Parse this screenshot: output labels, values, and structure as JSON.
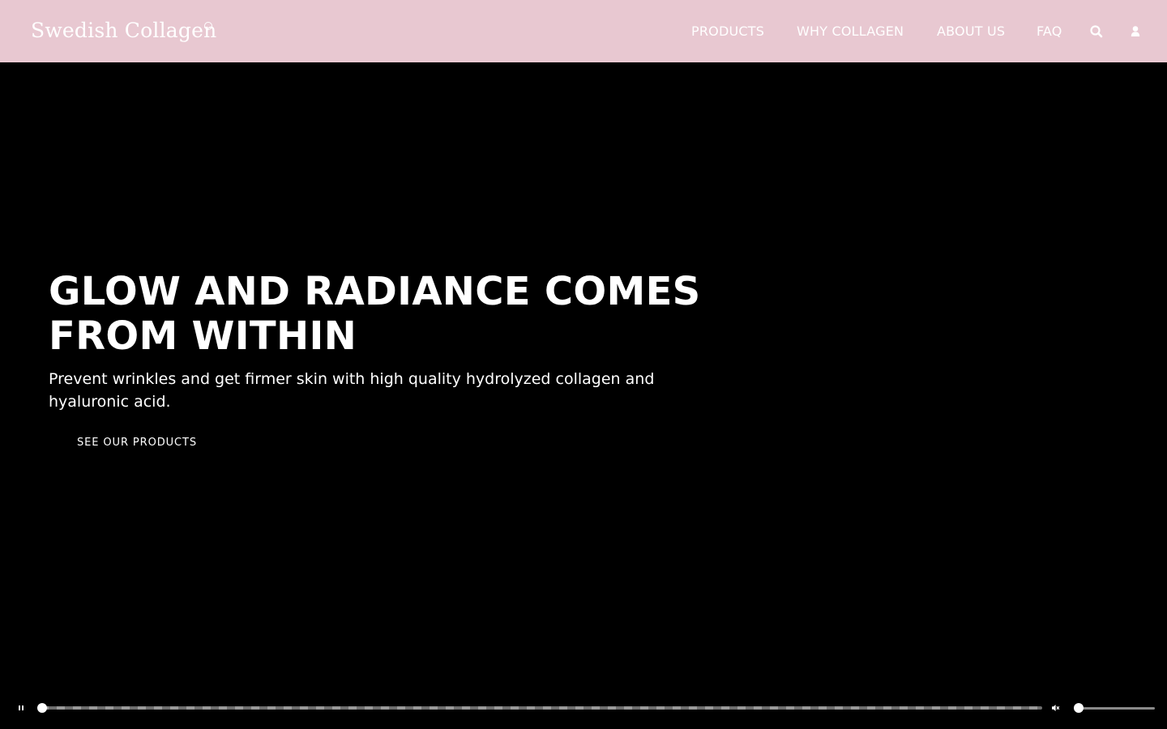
{
  "brand": {
    "name": "Swedish Collagen",
    "accent": "#e8c8d1"
  },
  "nav": {
    "items": [
      {
        "label": "PRODUCTS"
      },
      {
        "label": "WHY COLLAGEN"
      },
      {
        "label": "ABOUT US"
      },
      {
        "label": "FAQ"
      }
    ],
    "search_icon": "search-icon",
    "account_icon": "user-icon"
  },
  "hero": {
    "title": "GLOW AND RADIANCE COMES FROM WITHIN",
    "subtitle": "Prevent wrinkles and get firmer skin with high quality hydrolyzed collagen and hyaluronic acid.",
    "cta_label": "SEE OUR PRODUCTS",
    "background": "#000000"
  },
  "video_player": {
    "play_state_icon": "pause-icon",
    "progress": 0,
    "mute_icon": "muted-speaker-icon",
    "volume": 0
  }
}
